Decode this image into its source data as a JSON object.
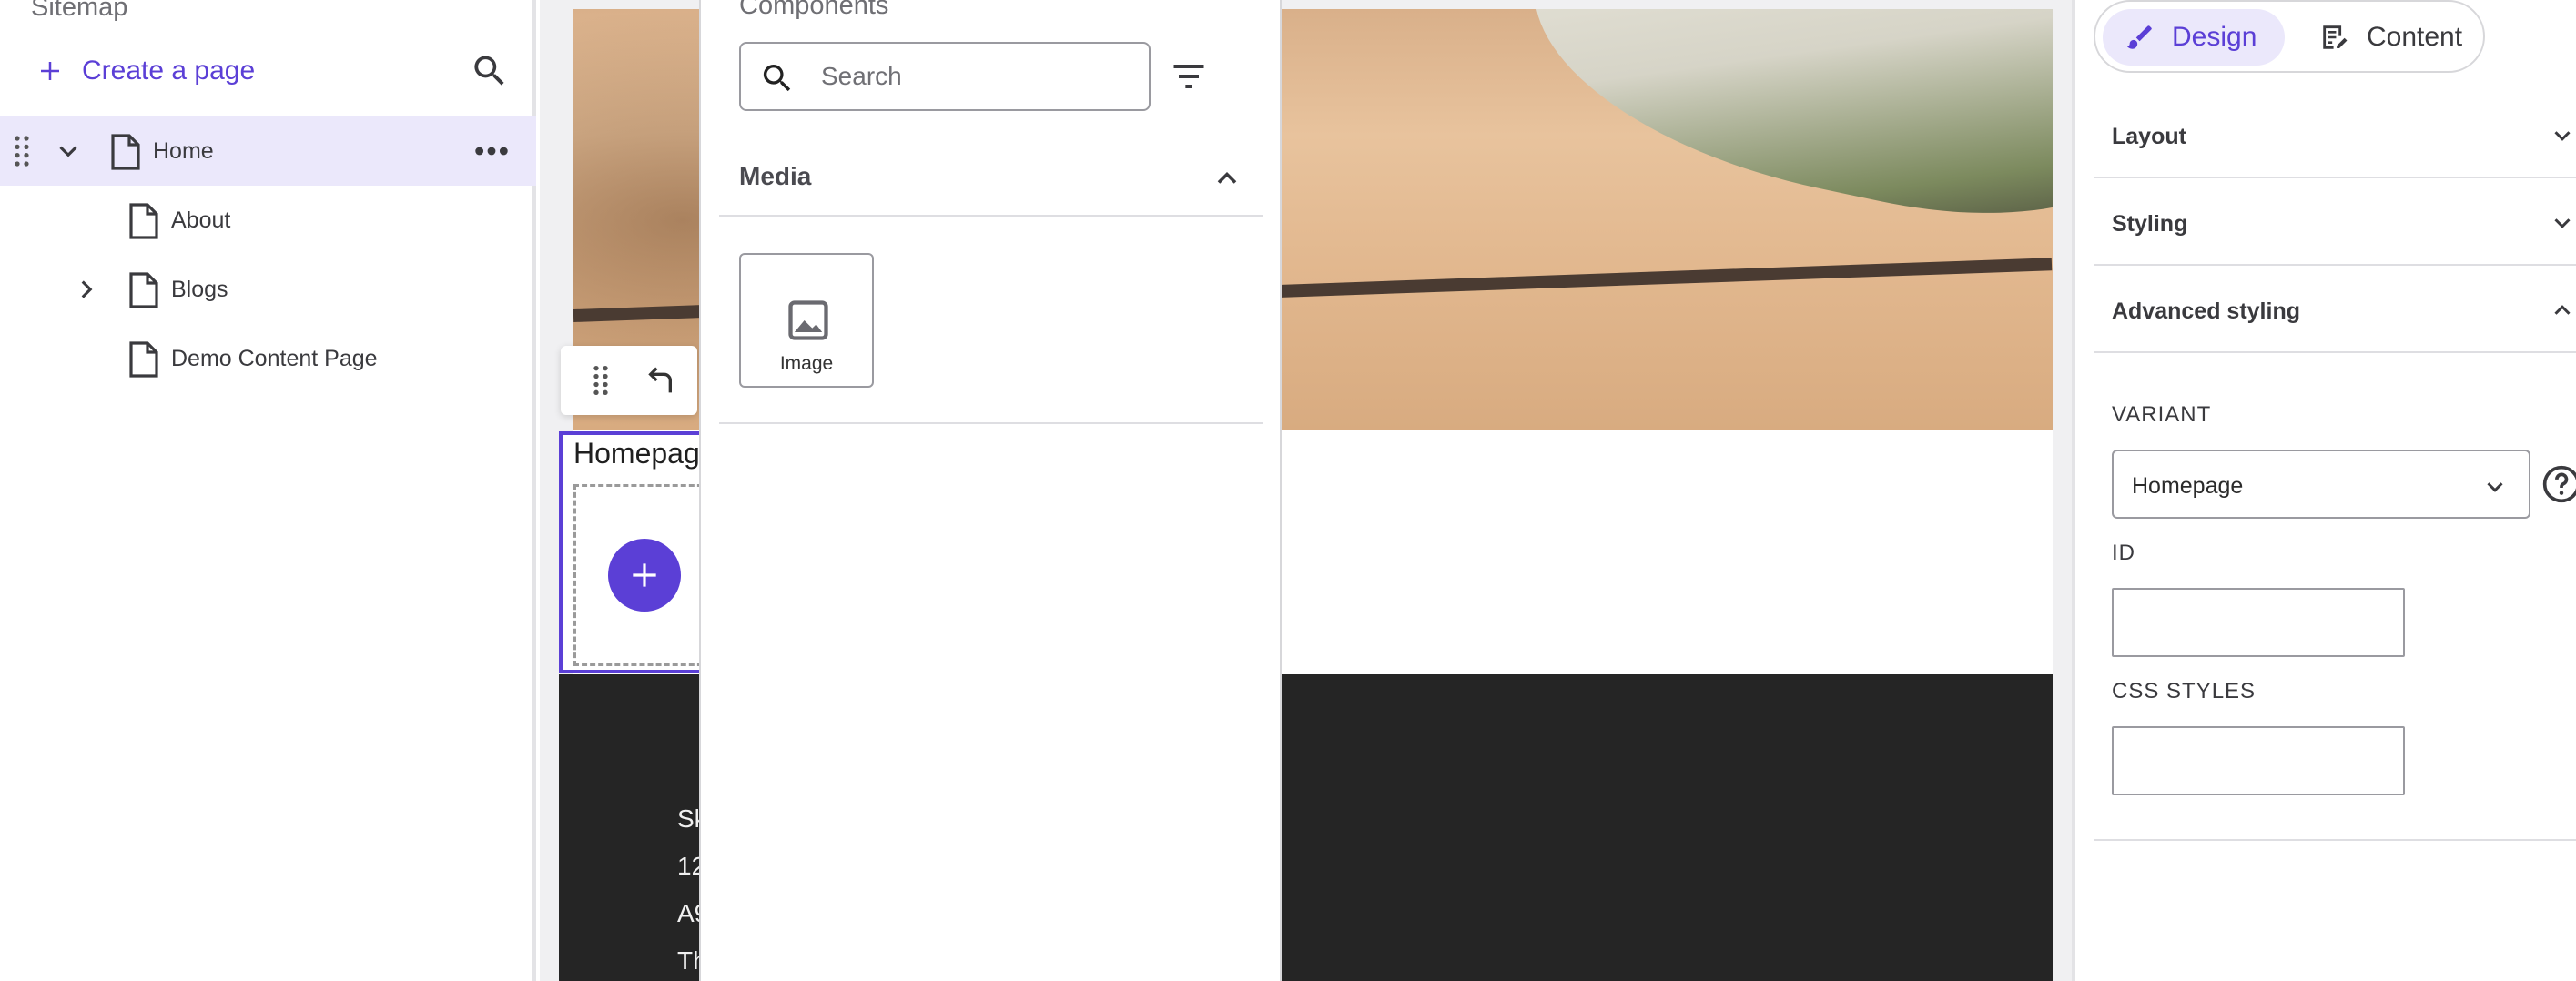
{
  "sitemap": {
    "title": "Sitemap",
    "create_label": "Create a page",
    "items": [
      {
        "label": "Home"
      },
      {
        "label": "About"
      },
      {
        "label": "Blogs"
      },
      {
        "label": "Demo Content Page"
      }
    ]
  },
  "components": {
    "title": "Components",
    "search_placeholder": "Search",
    "section_label": "Media",
    "tiles": [
      {
        "label": "Image"
      }
    ]
  },
  "canvas": {
    "block_title": "Homepage",
    "footer_lines": [
      "Sk",
      "12",
      "A9",
      "Th"
    ]
  },
  "properties": {
    "mode_design": "Design",
    "mode_content": "Content",
    "sections": [
      {
        "label": "Layout"
      },
      {
        "label": "Styling"
      },
      {
        "label": "Advanced styling"
      }
    ],
    "variant_label": "VARIANT",
    "variant_value": "Homepage",
    "id_label": "ID",
    "id_value": "",
    "css_label": "CSS STYLES",
    "css_value": ""
  },
  "colors": {
    "accent": "#5b3fd6",
    "selected_bg": "#ebe8fb",
    "footer_bg": "#252525"
  }
}
